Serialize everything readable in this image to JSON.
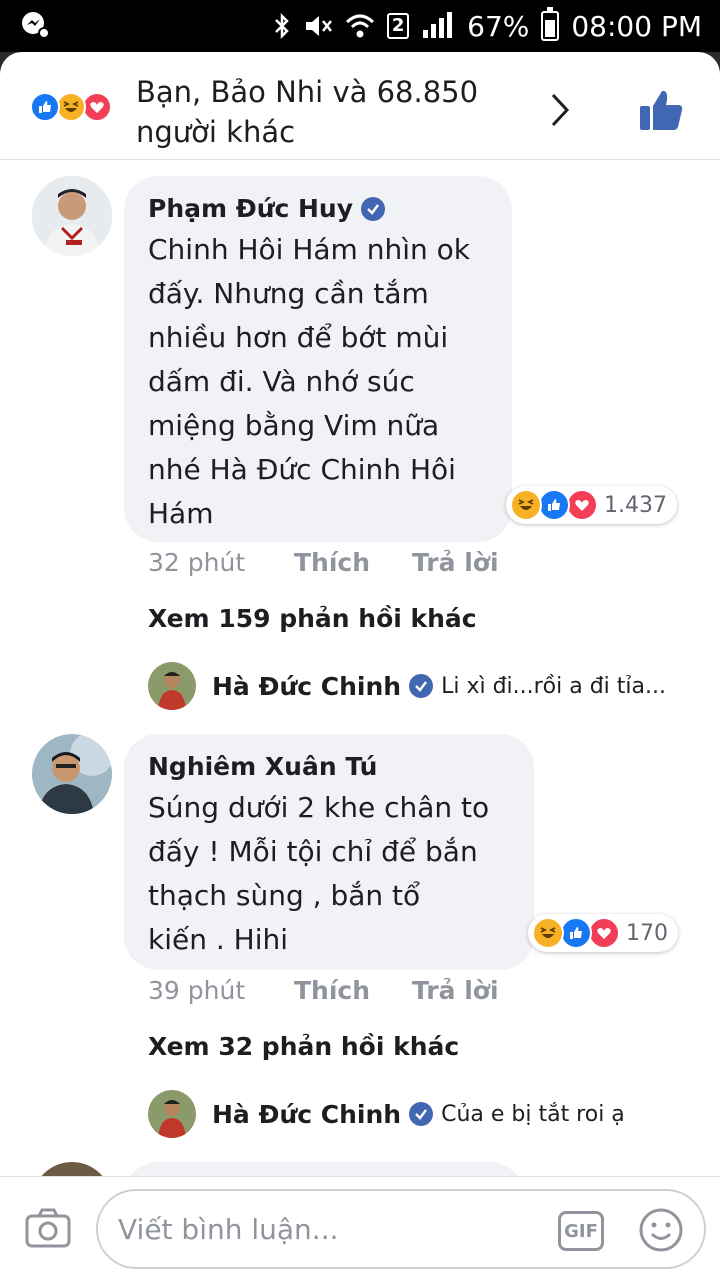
{
  "status_bar": {
    "battery": "67%",
    "time": "08:00 PM",
    "sim_slot": "2"
  },
  "reactions": {
    "summary_line1": "Bạn, Bảo Nhi và 68.850",
    "summary_line2": "người khác",
    "icons": [
      "like-icon",
      "haha-icon",
      "love-icon"
    ]
  },
  "comments": [
    {
      "author": "Phạm Đức Huy",
      "verified": true,
      "text": "Chinh Hôi Hám nhìn ok\nđấy. Nhưng cần tắm\nnhiều hơn để bớt mùi\ndấm đi. Và nhớ súc\nmiệng bằng Vim nữa\nnhé Hà Đức Chinh Hôi\nHám",
      "reaction_count": "1.437",
      "time": "32 phút",
      "like_label": "Thích",
      "reply_label": "Trả lời",
      "more_replies": "Xem 159 phản hồi khác",
      "reply_preview": {
        "author": "Hà Đức Chinh",
        "text": "Li xì đi...rồi a đi tỉa..."
      }
    },
    {
      "author": "Nghiêm Xuân Tú",
      "verified": false,
      "text": "Súng dưới 2 khe chân to\nđấy ! Mỗi tội chỉ để bắn\nthạch sùng , bắn tổ\nkiến . Hihi",
      "reaction_count": "170",
      "time": "39 phút",
      "like_label": "Thích",
      "reply_label": "Trả lời",
      "more_replies": "Xem 32 phản hồi khác",
      "reply_preview": {
        "author": "Hà Đức Chinh",
        "text": "Của e bị tắt roi ạ"
      }
    }
  ],
  "composer": {
    "placeholder": "Viết bình luận...",
    "gif_label": "GIF"
  },
  "colors": {
    "facebook_blue": "#4267b2",
    "like_blue": "#1877f2",
    "love_red": "#f33e58",
    "haha_yellow": "#f7b125",
    "bubble_gray": "#f0f2f5",
    "meta_gray": "#90949c"
  }
}
